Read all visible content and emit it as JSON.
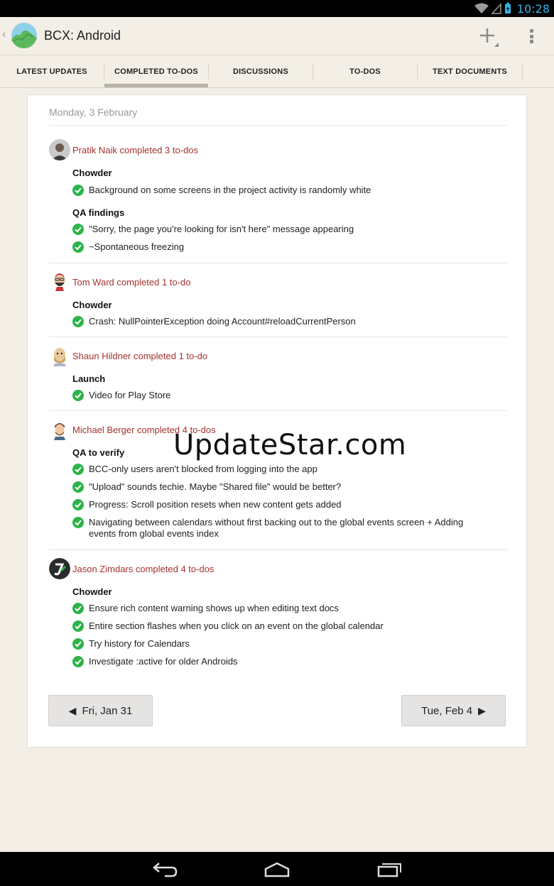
{
  "status_bar": {
    "time": "10:28"
  },
  "app": {
    "title": "BCX: Android"
  },
  "tabs": [
    {
      "label": "LATEST UPDATES"
    },
    {
      "label": "COMPLETED TO-DOS"
    },
    {
      "label": "DISCUSSIONS"
    },
    {
      "label": "TO-DOS"
    },
    {
      "label": "TEXT DOCUMENTS"
    }
  ],
  "active_tab": "COMPLETED TO-DOS",
  "day_heading": "Monday, 3 February",
  "entries": [
    {
      "person": "Pratik Naik completed 3 to-dos",
      "groups": [
        {
          "project": "Chowder",
          "items": [
            "Background on some screens in the project activity is randomly white"
          ]
        },
        {
          "project": "QA findings",
          "items": [
            "\"Sorry, the page you're looking for isn't here\" message appearing",
            "~Spontaneous freezing"
          ]
        }
      ]
    },
    {
      "person": "Tom Ward completed 1 to-do",
      "groups": [
        {
          "project": "Chowder",
          "items": [
            "Crash: NullPointerException doing Account#reloadCurrentPerson"
          ]
        }
      ]
    },
    {
      "person": "Shaun Hildner completed 1 to-do",
      "groups": [
        {
          "project": "Launch",
          "items": [
            "Video for Play Store"
          ]
        }
      ]
    },
    {
      "person": "Michael Berger completed 4 to-dos",
      "groups": [
        {
          "project": "QA to verify",
          "items": [
            "BCC-only users aren't blocked from logging into the app",
            "\"Upload\" sounds techie. Maybe \"Shared file\" would be better?",
            "Progress: Scroll position resets when new content gets added",
            "Navigating between calendars without first backing out to the global events screen + Adding events from global events index"
          ]
        }
      ]
    },
    {
      "person": "Jason Zimdars completed 4 to-dos",
      "groups": [
        {
          "project": "Chowder",
          "items": [
            "Ensure rich content warning shows up when editing text docs",
            "Entire section flashes when you click on an event on the global calendar",
            "Try history for Calendars",
            "Investigate :active for older Androids"
          ]
        }
      ]
    }
  ],
  "nav": {
    "prev": "Fri, Jan 31",
    "next": "Tue, Feb 4"
  },
  "watermark": "UpdateStar.com",
  "colors": {
    "accent_text": "#a3322f",
    "check_green": "#2db34a",
    "holo_blue": "#33b5e5"
  }
}
